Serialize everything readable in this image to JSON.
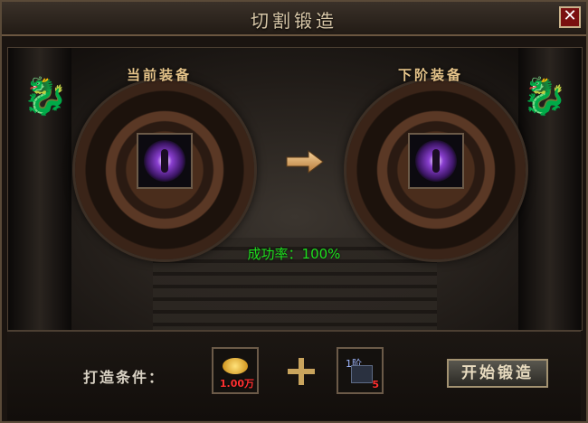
{
  "window": {
    "title": "切割锻造"
  },
  "current": {
    "label": "当前装备"
  },
  "next": {
    "label": "下阶装备"
  },
  "success": {
    "text": "成功率：100%"
  },
  "requirements": {
    "label": "打造条件：",
    "gold": {
      "value": "1.00万"
    },
    "shard": {
      "tier": "1阶",
      "count": "5"
    }
  },
  "actions": {
    "start_label": "开始锻造"
  },
  "colors": {
    "success_green": "#1fe11f",
    "label_gold": "#e6c48a",
    "close_red": "#7a1010"
  },
  "icons": [
    "close-icon",
    "equipment-icon",
    "arrow-right-icon",
    "gold-icon",
    "plus-icon",
    "shard-icon"
  ]
}
